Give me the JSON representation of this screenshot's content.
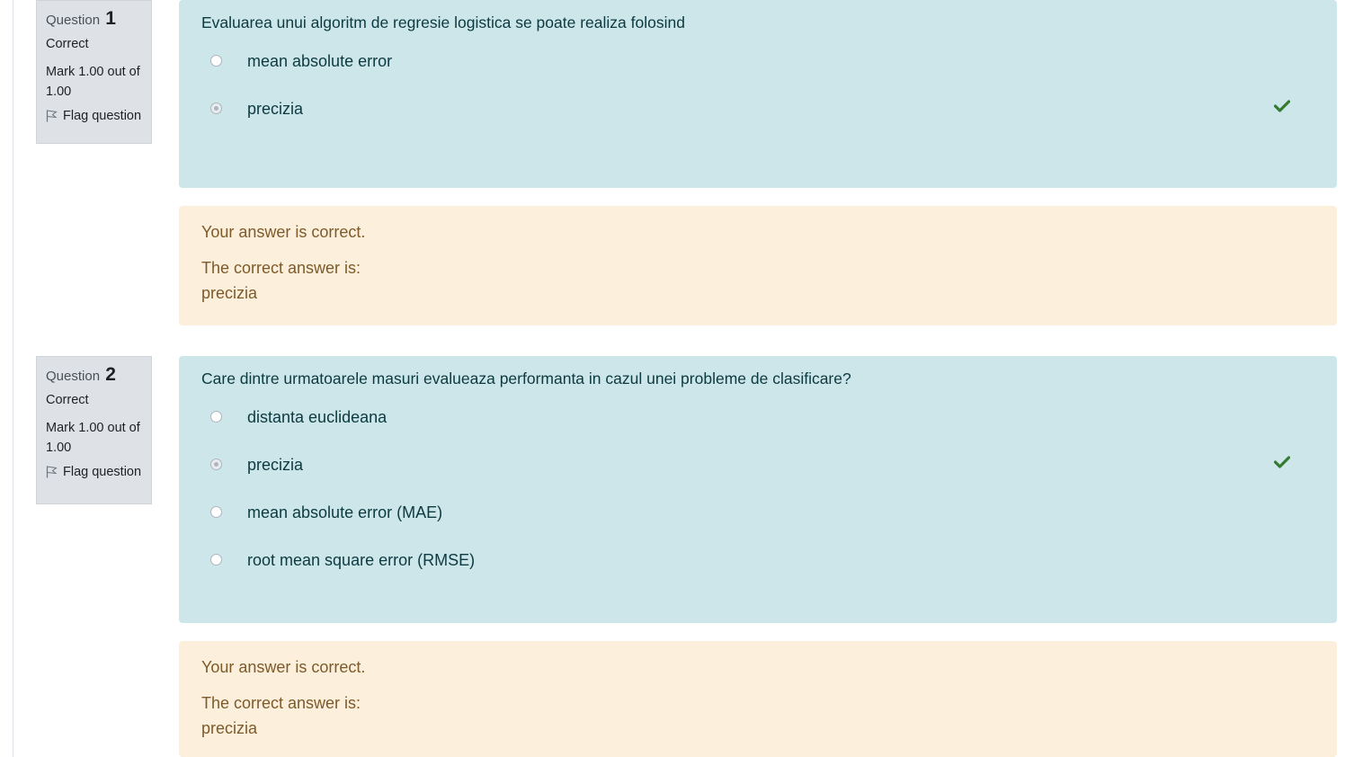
{
  "questions": [
    {
      "label": "Question",
      "number": "1",
      "state": "Correct",
      "grade": "Mark 1.00 out of 1.00",
      "flag_label": "Flag question",
      "text": "Evaluarea unui algoritm de regresie logistica se poate realiza folosind",
      "options": [
        {
          "label": "mean absolute error",
          "selected": false,
          "correct_mark": false
        },
        {
          "label": "precizia",
          "selected": true,
          "correct_mark": true
        }
      ],
      "feedback": "Your answer is correct.",
      "right_answer_intro": "The correct answer is:",
      "right_answer": "precizia"
    },
    {
      "label": "Question",
      "number": "2",
      "state": "Correct",
      "grade": "Mark 1.00 out of 1.00",
      "flag_label": "Flag question",
      "text": "Care dintre urmatoarele masuri evalueaza performanta in cazul unei probleme de clasificare?",
      "options": [
        {
          "label": "distanta euclideana",
          "selected": false,
          "correct_mark": false
        },
        {
          "label": "precizia",
          "selected": true,
          "correct_mark": true
        },
        {
          "label": "mean absolute error (MAE)",
          "selected": false,
          "correct_mark": false
        },
        {
          "label": "root mean square error (RMSE)",
          "selected": false,
          "correct_mark": false
        }
      ],
      "feedback": "Your answer is correct.",
      "right_answer_intro": "The correct answer is:",
      "right_answer": "precizia"
    }
  ],
  "colors": {
    "info_bg": "#dee2e6",
    "formulation_bg": "#cce6ea",
    "outcome_bg": "#fcefdc",
    "check": "#357a32"
  },
  "icons": {
    "flag": "flag-icon",
    "correct": "check-icon"
  }
}
